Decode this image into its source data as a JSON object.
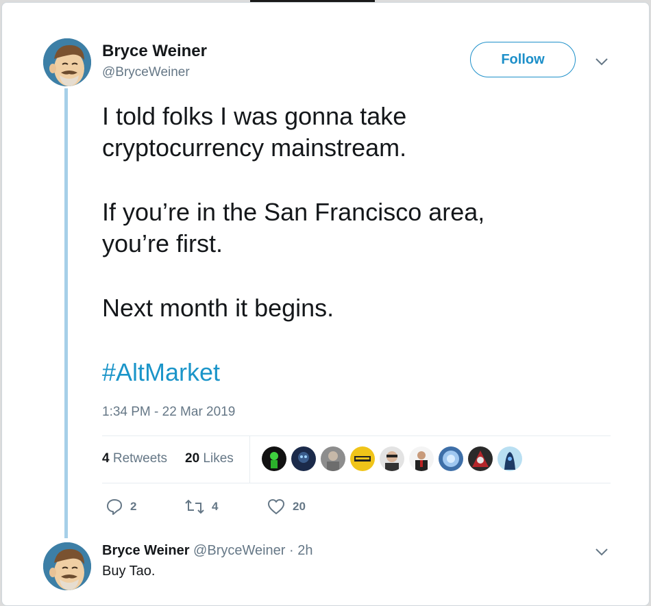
{
  "tweet": {
    "author_name": "Bryce Weiner",
    "author_handle": "@BryceWeiner",
    "follow_label": "Follow",
    "text_lines": [
      "I told folks I was gonna take",
      "cryptocurrency mainstream.",
      "If you’re in the San Francisco area,",
      "you’re first.",
      "Next month it begins."
    ],
    "hashtag": "#AltMarket",
    "timestamp": "1:34 PM - 22 Mar 2019",
    "retweets_count": "4",
    "retweets_label": "Retweets",
    "likes_count": "20",
    "likes_label": "Likes",
    "actions": {
      "reply_count": "2",
      "retweet_count": "4",
      "like_count": "20"
    }
  },
  "reply": {
    "author_name": "Bryce Weiner",
    "author_handle": "@BryceWeiner",
    "separator": "·",
    "time": "2h",
    "text": "Buy Tao."
  },
  "colors": {
    "link": "#1b95c9",
    "thread_line": "#a6cfe8",
    "muted": "#657786"
  }
}
